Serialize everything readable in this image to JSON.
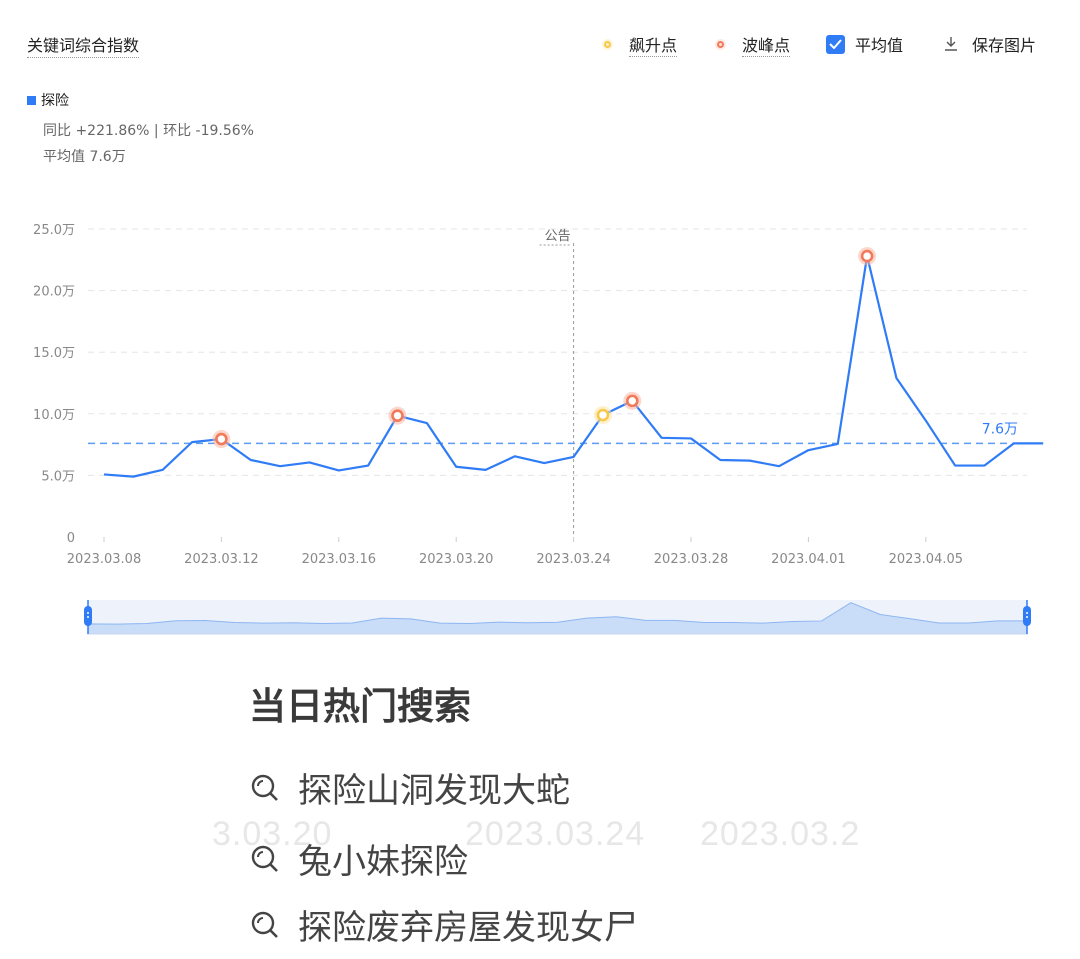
{
  "header": {
    "title": "关键词综合指数",
    "tools": {
      "rising_point": "飙升点",
      "peak_point": "波峰点",
      "average": "平均值",
      "save_image": "保存图片"
    }
  },
  "legend": {
    "series_name": "探险",
    "yoy_mom": "同比 +221.86% | 环比 -19.56%",
    "average_text": "平均值 7.6万"
  },
  "colors": {
    "line": "#2f7cf6",
    "peak": "#f07a5a",
    "rising": "#f7c84b",
    "grid": "#e3e6ea"
  },
  "chart_data": {
    "type": "line",
    "x": [
      "2023.03.08",
      "2023.03.09",
      "2023.03.10",
      "2023.03.11",
      "2023.03.12",
      "2023.03.13",
      "2023.03.14",
      "2023.03.15",
      "2023.03.16",
      "2023.03.17",
      "2023.03.18",
      "2023.03.19",
      "2023.03.20",
      "2023.03.21",
      "2023.03.22",
      "2023.03.23",
      "2023.03.24",
      "2023.03.25",
      "2023.03.26",
      "2023.03.27",
      "2023.03.28",
      "2023.03.29",
      "2023.03.30",
      "2023.03.31",
      "2023.04.01",
      "2023.04.02",
      "2023.04.03",
      "2023.04.04",
      "2023.04.05",
      "2023.04.06",
      "2023.04.07",
      "2023.04.08",
      "2023.04.09"
    ],
    "series": [
      {
        "name": "探险",
        "values": [
          50800,
          49000,
          54500,
          77000,
          79500,
          62500,
          57500,
          60500,
          54000,
          58000,
          98500,
          92500,
          57000,
          54500,
          65500,
          60000,
          65000,
          99000,
          110500,
          80500,
          80000,
          62500,
          62000,
          57500,
          70500,
          75500,
          228000,
          129000,
          94500,
          58000,
          58000,
          76000,
          76000
        ]
      }
    ],
    "x_tick_labels": [
      "2023.03.08",
      "2023.03.12",
      "2023.03.16",
      "2023.03.20",
      "2023.03.24",
      "2023.03.28",
      "2023.04.01",
      "2023.04.05"
    ],
    "y_tick_labels": [
      "0",
      "5.0万",
      "10.0万",
      "15.0万",
      "20.0万",
      "25.0万"
    ],
    "ylim": [
      0,
      250000
    ],
    "average": 76000,
    "average_label": "7.6万",
    "annotation": {
      "date": "2023.03.24",
      "label": "公告"
    },
    "peak_points": [
      "2023.03.12",
      "2023.03.18",
      "2023.03.26",
      "2023.04.03"
    ],
    "rising_points": [
      "2023.03.25"
    ],
    "grid": true
  },
  "overlay": {
    "title": "当日热门搜索",
    "items": [
      "探险山洞发现大蛇",
      "兔小妹探险",
      "探险废弃房屋发现女尸"
    ],
    "ghost_ticks": [
      "3.03.20",
      "2023.03.24",
      "2023.03.2"
    ]
  }
}
